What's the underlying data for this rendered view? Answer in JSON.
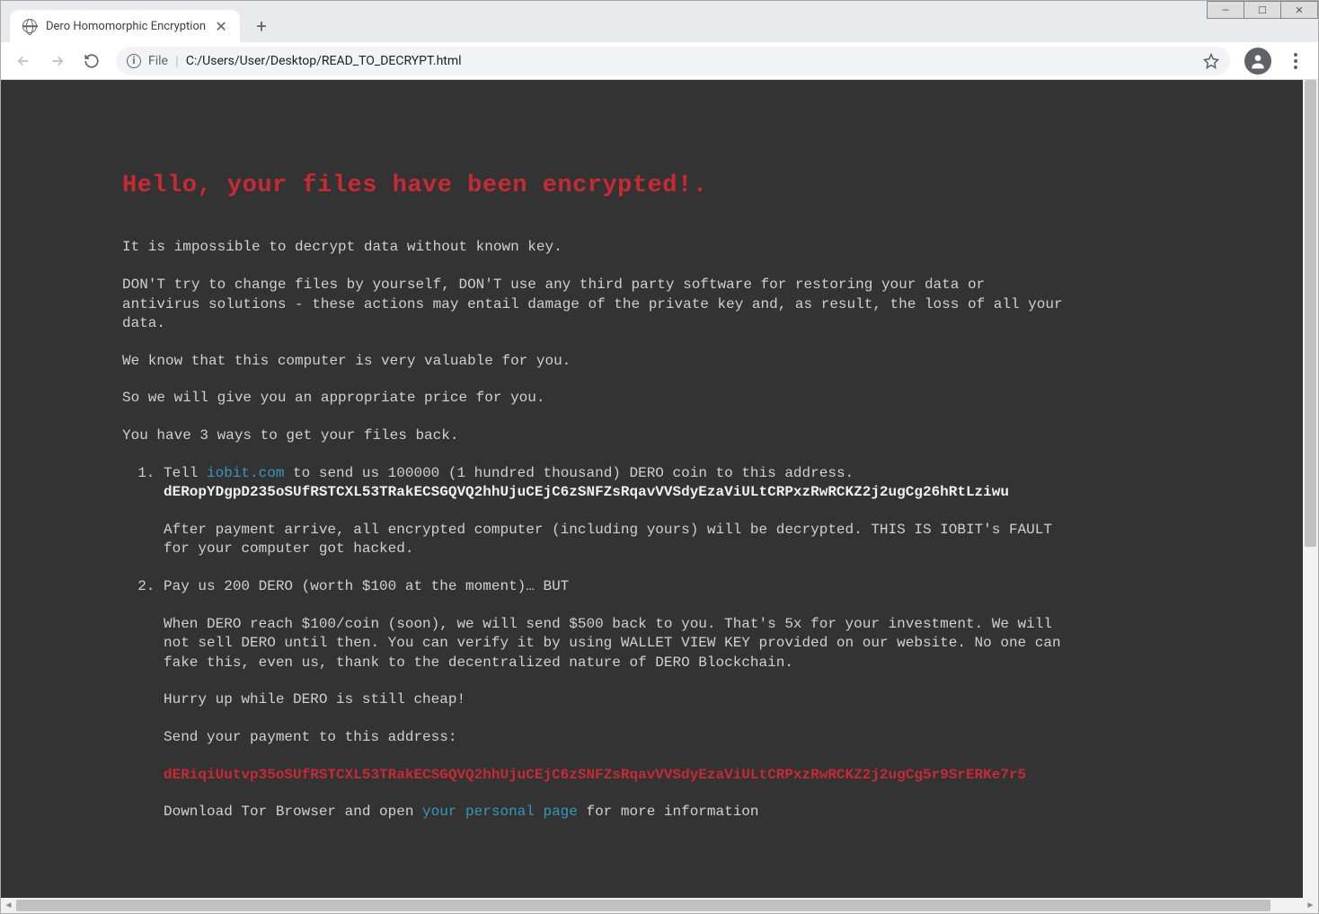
{
  "window": {
    "minimize": "—",
    "maximize": "☐",
    "close": "✕"
  },
  "tab": {
    "title": "Dero Homomorphic Encryption"
  },
  "address": {
    "label": "File",
    "separator": "|",
    "url": "C:/Users/User/Desktop/READ_TO_DECRYPT.html"
  },
  "ransom": {
    "heading": "Hello, your files have been encrypted!.",
    "p1": "It is impossible to decrypt data without known key.",
    "p2": "DON'T try to change files by yourself, DON'T use any third party software for restoring your data or antivirus solutions - these actions may entail damage of the private key and, as result, the loss of all your data.",
    "p3": "We know that this computer is very valuable for you.",
    "p4": "So we will give you an appropriate price for you.",
    "p5": "You have 3 ways to get your files back.",
    "li1_a": "Tell ",
    "li1_link": "iobit.com",
    "li1_b": " to send us 100000 (1 hundred thousand) DERO coin to this address. ",
    "li1_addr": "dERopYDgpD235oSUfRSTCXL53TRakECSGQVQ2hhUjuCEjC6zSNFZsRqavVVSdyEzaViULtCRPxzRwRCKZ2j2ugCg26hRtLziwu",
    "li1_c": "After payment arrive, all encrypted computer (including yours) will be decrypted. THIS IS IOBIT's FAULT for your computer got hacked.",
    "li2_a": "Pay us 200 DERO (worth $100 at the moment)… BUT",
    "li2_b": "When DERO reach $100/coin (soon), we will send $500 back to you. That's 5x for your investment. We will not sell DERO until then. You can verify it by using WALLET VIEW KEY provided on our website. No one can fake this, even us, thank to the decentralized nature of DERO Blockchain.",
    "li2_c": "Hurry up while DERO is still cheap!",
    "li2_d": "Send your payment to this address:",
    "li2_addr": "dERiqiUutvp35oSUfRSTCXL53TRakECSGQVQ2hhUjuCEjC6zSNFZsRqavVVSdyEzaViULtCRPxzRwRCKZ2j2ugCg5r9SrERKe7r5",
    "li2_e_a": "Download Tor Browser and open ",
    "li2_e_link": "your personal page",
    "li2_e_b": " for more information"
  }
}
